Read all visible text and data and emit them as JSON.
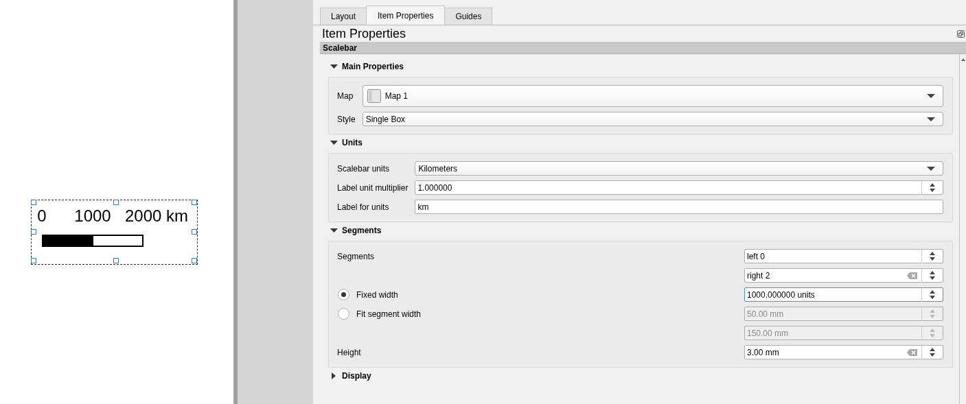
{
  "canvas": {
    "scalebar": {
      "selected": true,
      "labels": [
        "0",
        "1000",
        "2000 km"
      ],
      "segments": [
        {
          "filled": true
        },
        {
          "filled": false
        }
      ]
    }
  },
  "tabs": [
    {
      "label": "Layout",
      "selected": false
    },
    {
      "label": "Item Properties",
      "selected": true
    },
    {
      "label": "Guides",
      "selected": false
    }
  ],
  "panel_title": "Item Properties",
  "item_type": "Scalebar",
  "groups": [
    {
      "title": "Main Properties",
      "expanded": true,
      "rows": [
        {
          "kind": "layer-combo",
          "label": "Map",
          "value": "Map 1"
        },
        {
          "kind": "combo",
          "label": "Style",
          "value": "Single Box"
        }
      ]
    },
    {
      "title": "Units",
      "expanded": true,
      "rows": [
        {
          "kind": "combo",
          "label": "Scalebar units",
          "value": "Kilometers"
        },
        {
          "kind": "spin",
          "label": "Label unit multiplier",
          "value": "1.000000",
          "clearable": false,
          "focused": false,
          "disabled": false
        },
        {
          "kind": "text",
          "label": "Label for units",
          "value": "km"
        }
      ]
    },
    {
      "title": "Segments",
      "expanded": true,
      "rows": [
        {
          "kind": "spin",
          "label": "Segments",
          "value": "left 0",
          "clearable": false,
          "focused": false,
          "disabled": false
        },
        {
          "kind": "spin",
          "value": "right 2",
          "clearable": true,
          "focused": false,
          "disabled": false
        },
        {
          "kind": "radio",
          "label": "Fixed width",
          "selected": true,
          "value": "1000.000000 units",
          "clearable": false,
          "focused": true,
          "disabled": false
        },
        {
          "kind": "radio",
          "label": "Fit segment width",
          "selected": false,
          "value": "50.00 mm",
          "clearable": false,
          "focused": false,
          "disabled": true
        },
        {
          "kind": "spin",
          "value": "150.00 mm",
          "clearable": false,
          "focused": false,
          "disabled": true
        },
        {
          "kind": "spin",
          "label": "Height",
          "value": "3.00 mm",
          "clearable": true,
          "focused": false,
          "disabled": false
        }
      ]
    },
    {
      "title": "Display",
      "expanded": false
    }
  ]
}
